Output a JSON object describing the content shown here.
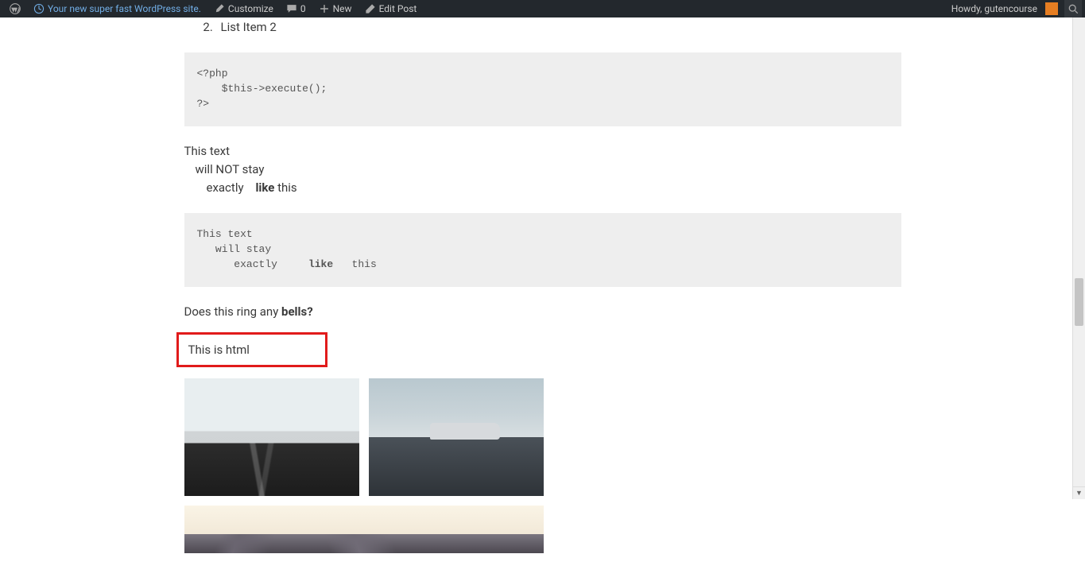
{
  "adminbar": {
    "site_title": "Your new super fast WordPress site.",
    "customize": "Customize",
    "comments_count": "0",
    "new": "New",
    "edit_post": "Edit Post",
    "howdy": "Howdy, gutencourse"
  },
  "content": {
    "list_item_2": "List Item 2",
    "code1": "<?php\n    $this->execute();\n?>",
    "para1": {
      "l1": "This text",
      "l2": "will NOT stay",
      "l3a": "exactly",
      "l3b": "like",
      "l3c": " this"
    },
    "code2_l1": "This text",
    "code2_l2": "   will stay",
    "code2_l3_pre": "      exactly     ",
    "code2_l3_bold": "like",
    "code2_l3_post": "   this",
    "para2_pre": "Does this ring any ",
    "para2_bold": "bells?",
    "html_text": "This is html"
  }
}
